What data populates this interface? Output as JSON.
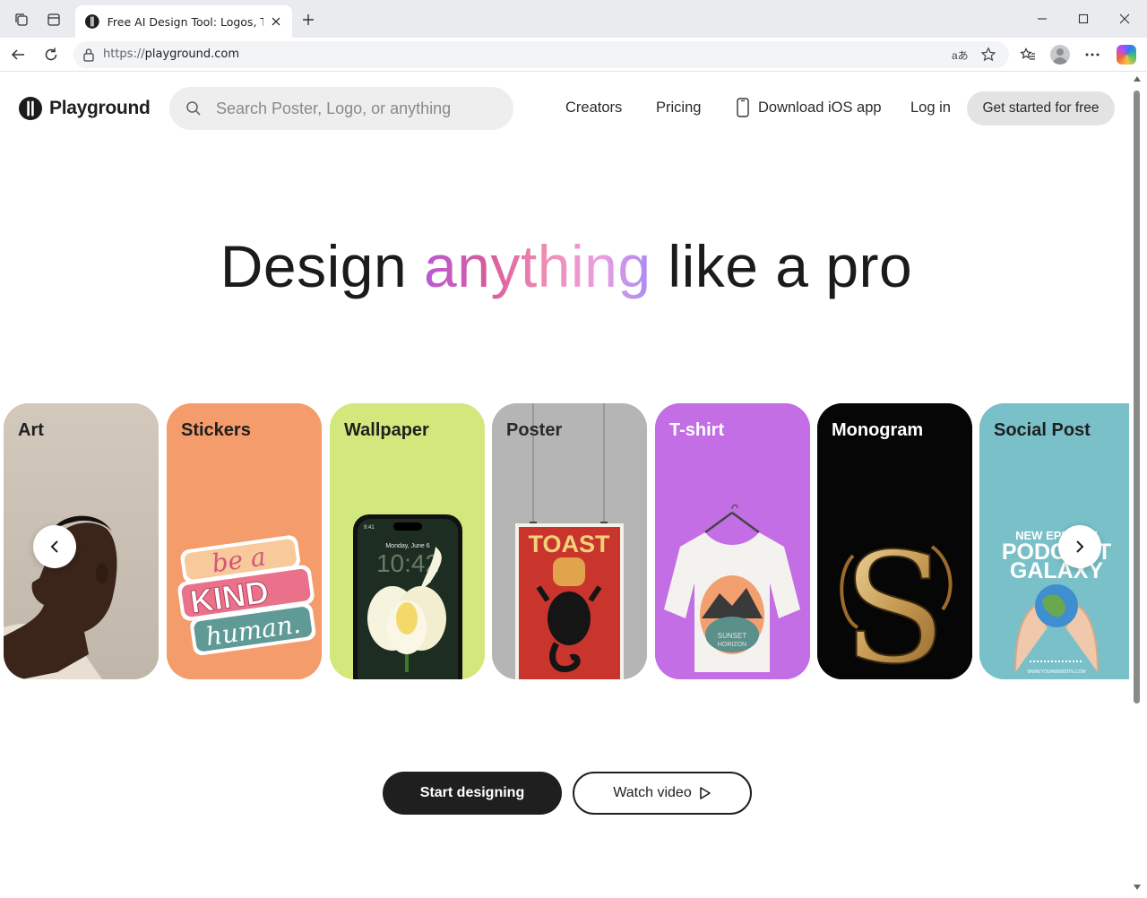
{
  "browser": {
    "tab_title": "Free AI Design Tool: Logos, T-Shirts",
    "url_protocol": "https://",
    "url_host": "playground.com",
    "read_aloud_label": "aあ"
  },
  "header": {
    "brand": "Playground",
    "search_placeholder": "Search Poster, Logo, or anything",
    "nav": {
      "creators": "Creators",
      "pricing": "Pricing",
      "download_ios": "Download iOS app",
      "login": "Log in",
      "get_started": "Get started for free"
    }
  },
  "hero": {
    "before": "Design ",
    "highlight": "anything",
    "after": " like a pro"
  },
  "cards": [
    {
      "label": "Art",
      "bg": "#c9bfb4",
      "label_color": "#1f1f1f"
    },
    {
      "label": "Stickers",
      "bg": "#f49c6b",
      "label_color": "#1f1f1f",
      "art_text": [
        "be a",
        "KIND",
        "human."
      ]
    },
    {
      "label": "Wallpaper",
      "bg": "#d3e87c",
      "label_color": "#1f1f1f",
      "art_text": [
        "9:41",
        "Monday, June 6",
        "10:42"
      ]
    },
    {
      "label": "Poster",
      "bg": "#b5b5b5",
      "label_color": "#2a2a2a",
      "art_text": [
        "TOAST"
      ]
    },
    {
      "label": "T-shirt",
      "bg": "#c46ee6",
      "label_color": "#ffffff",
      "art_text": [
        "SUNSET",
        "HORIZON"
      ]
    },
    {
      "label": "Monogram",
      "bg": "#060606",
      "label_color": "#ffffff",
      "art_text": [
        "S"
      ]
    },
    {
      "label": "Social Post",
      "bg": "#79c0c8",
      "label_color": "#1f1f1f",
      "art_text": [
        "NEW EPISODE",
        "PODCAST",
        "GALAXY",
        "WWW.YOURWEBSITE.COM"
      ]
    }
  ],
  "actions": {
    "start": "Start designing",
    "watch": "Watch video"
  },
  "colors": {
    "primary_button": "#1f1f1f",
    "secondary_bg": "#e3e3e3"
  }
}
